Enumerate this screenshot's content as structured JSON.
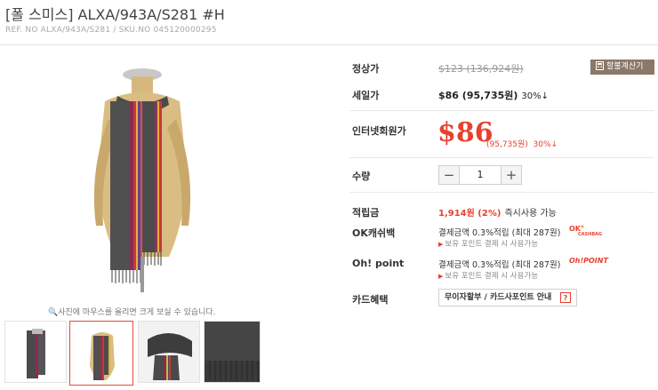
{
  "product": {
    "title": "[폴 스미스] ALXA/943A/S281 #H",
    "ref_line": "REF. NO ALXA/943A/S281 / SKU.NO 045120000295"
  },
  "gallery": {
    "hint": "사진에 마우스를 올리면 크게 보실 수 있습니다.",
    "thumbnail_count": 4,
    "selected_thumbnail": 2
  },
  "price": {
    "regular_label": "정상가",
    "regular_value": "$123 (136,924원)",
    "calc_button": "할불계산기",
    "sale_label": "세일가",
    "sale_value": "$86 (95,735원)",
    "sale_rate": "30%↓",
    "net_label": "인터넷회원가",
    "net_value": "$86",
    "net_krw": "(95,735원)",
    "net_rate": "30%↓"
  },
  "quantity": {
    "label": "수량",
    "minus": "−",
    "value": "1",
    "plus": "+"
  },
  "points": {
    "label": "적립금",
    "amount": "1,914원 (2%)",
    "instant": "즉시사용 가능"
  },
  "ok_cashbag": {
    "label": "OK캐쉬백",
    "detail": "결제금액 0.3%적립 (최대 287원)",
    "note": "보유 포인트 결제 시 사용가능",
    "logo_text": "OK CASHBAG"
  },
  "oh_point": {
    "label": "Oh! point",
    "detail": "결제금액 0.3%적립 (최대 287원)",
    "note": "보유 포인트 결제 시 사용가능",
    "logo_text": "Oh!POINT"
  },
  "card": {
    "label": "카드혜택",
    "button": "무이자할부 / 카드사포인트 안내",
    "help": "?"
  },
  "colors": {
    "accent_red": "#e8402f",
    "calc_button_bg": "#8b7869",
    "thumb_active_border": "#e24a3b"
  }
}
